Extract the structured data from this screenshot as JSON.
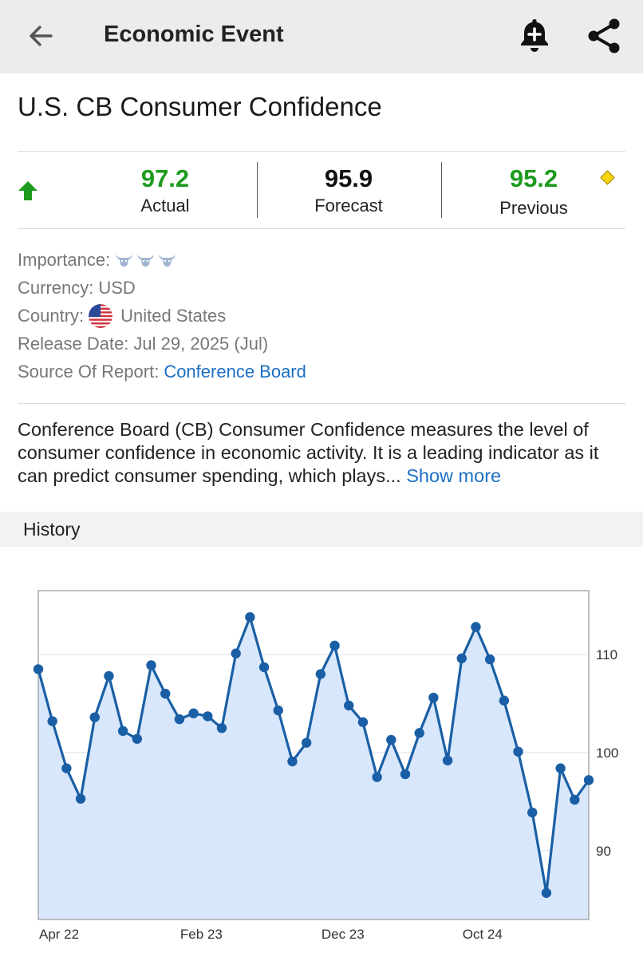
{
  "appbar": {
    "title": "Economic Event",
    "back_icon": "arrow-left-icon",
    "alert_icon": "bell-plus-icon",
    "share_icon": "share-icon"
  },
  "event": {
    "title": "U.S. CB Consumer Confidence"
  },
  "stats": {
    "actual": {
      "value": "97.2",
      "label": "Actual",
      "color": "#1e9b1e"
    },
    "forecast": {
      "value": "95.9",
      "label": "Forecast",
      "color": "#111111"
    },
    "previous": {
      "value": "95.2",
      "label": "Previous",
      "color": "#1e9b1e"
    },
    "trend_icon": "arrow-up-icon",
    "revision_icon": "diamond-icon"
  },
  "details": {
    "importance_label": "Importance:",
    "importance_level": 3,
    "currency_label": "Currency:",
    "currency_value": "USD",
    "country_label": "Country:",
    "country_value": "United States",
    "release_label": "Release Date:",
    "release_value": "Jul 29, 2025 (Jul)",
    "source_label": "Source Of Report:",
    "source_value": "Conference Board"
  },
  "description": {
    "text": "Conference Board (CB) Consumer Confidence measures the level of consumer confidence in economic activity. It is a leading indicator as it can predict consumer spending, which plays...",
    "more": "Show more"
  },
  "history": {
    "title": "History"
  },
  "chart_data": {
    "type": "area",
    "x_tick_labels": [
      "Apr 22",
      "Feb 23",
      "Dec 23",
      "Oct 24"
    ],
    "y_tick_labels": [
      "110",
      "100",
      "90"
    ],
    "y_ticks": [
      110,
      100,
      90
    ],
    "ylim": [
      83,
      116.5
    ],
    "grid": true,
    "y_axis_position": "right",
    "line_color": "#1a5fa5",
    "fill_color": "#d8e7fb",
    "values": [
      108.5,
      103.2,
      98.4,
      95.3,
      103.6,
      107.8,
      102.2,
      101.4,
      108.9,
      106.0,
      103.4,
      104.0,
      103.7,
      102.5,
      110.1,
      113.8,
      108.7,
      104.3,
      99.1,
      101.0,
      108.0,
      110.9,
      104.8,
      103.1,
      97.5,
      101.3,
      97.8,
      102.0,
      105.6,
      99.2,
      109.6,
      112.8,
      109.5,
      105.3,
      100.1,
      93.9,
      85.7,
      98.4,
      95.2,
      97.2
    ]
  }
}
